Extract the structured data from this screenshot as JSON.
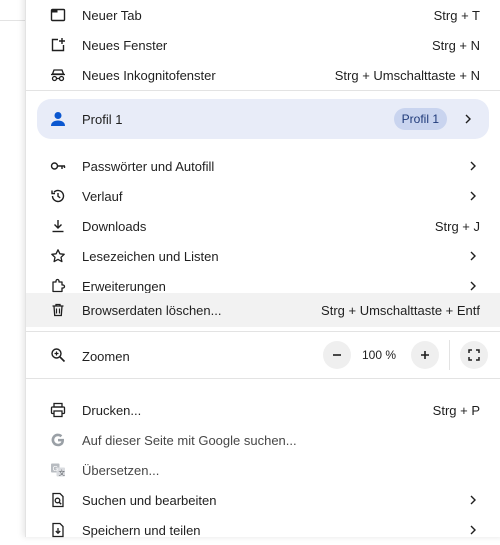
{
  "menu": {
    "group1": [
      {
        "label": "Neuer Tab",
        "shortcut": "Strg + T",
        "icon": "new-tab-icon"
      },
      {
        "label": "Neues Fenster",
        "shortcut": "Strg + N",
        "icon": "new-window-icon"
      },
      {
        "label": "Neues Inkognitofenster",
        "shortcut": "Strg + Umschalttaste + N",
        "icon": "incognito-icon"
      }
    ],
    "profile": {
      "label": "Profil 1",
      "chip": "Profil 1",
      "icon": "person-icon"
    },
    "group2": [
      {
        "label": "Passwörter und Autofill",
        "icon": "key-icon",
        "submenu": true
      },
      {
        "label": "Verlauf",
        "icon": "history-icon",
        "submenu": true
      },
      {
        "label": "Downloads",
        "shortcut": "Strg + J",
        "icon": "download-icon"
      },
      {
        "label": "Lesezeichen und Listen",
        "icon": "star-icon",
        "submenu": true
      },
      {
        "label": "Erweiterungen",
        "icon": "extension-icon",
        "submenu": true
      },
      {
        "label": "Browserdaten löschen...",
        "shortcut": "Strg + Umschalttaste + Entf",
        "icon": "trash-icon"
      }
    ],
    "zoom": {
      "label": "Zoomen",
      "value": "100 %",
      "minus": "−",
      "plus": "+"
    },
    "group3": [
      {
        "label": "Drucken...",
        "shortcut": "Strg + P",
        "icon": "print-icon"
      },
      {
        "label": "Auf dieser Seite mit Google suchen...",
        "icon": "google-icon"
      },
      {
        "label": "Übersetzen...",
        "icon": "translate-icon"
      },
      {
        "label": "Suchen und bearbeiten",
        "icon": "find-icon",
        "submenu": true
      },
      {
        "label": "Speichern und teilen",
        "icon": "save-icon",
        "submenu": true
      }
    ]
  },
  "colors": {
    "hover": "#f2f2f2",
    "profile_bg": "#e8ecf8",
    "chip_bg": "#c9d4ef",
    "accent": "#0b57d0"
  }
}
